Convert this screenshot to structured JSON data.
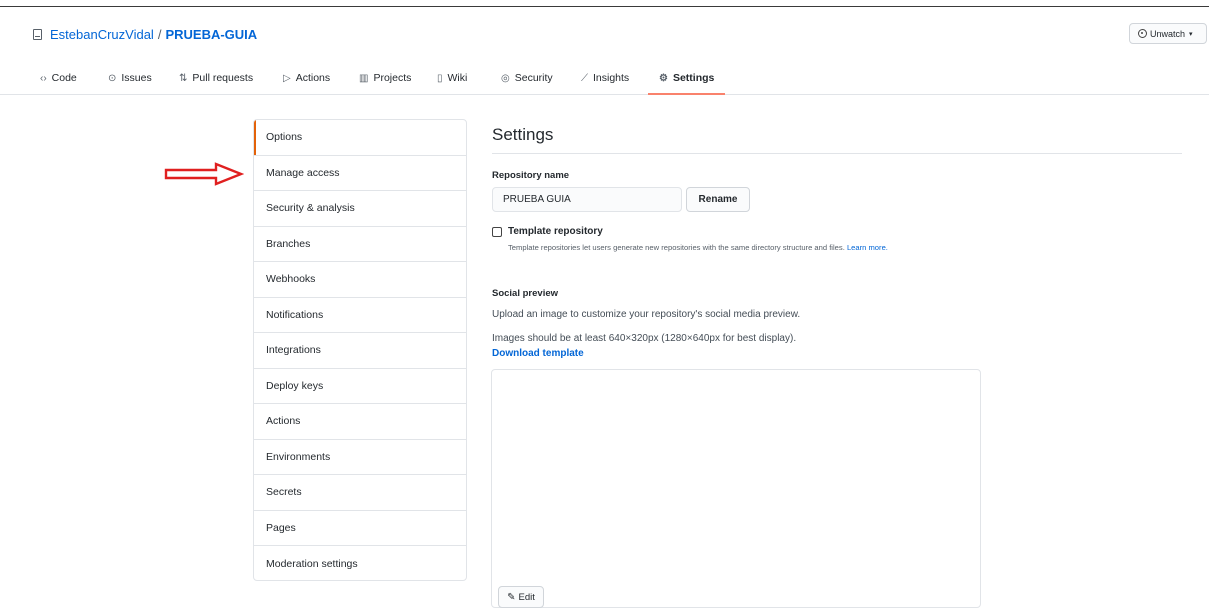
{
  "repo": {
    "owner": "EstebanCruzVidal",
    "separator": "/",
    "name": "PRUEBA-GUIA",
    "icon": "repo-icon"
  },
  "watch": {
    "label": "Unwatch",
    "icon": "eye-icon"
  },
  "tabs": [
    {
      "label": "Code",
      "icon": "code-icon",
      "glyph": "‹›"
    },
    {
      "label": "Issues",
      "icon": "issue-icon",
      "glyph": "⊙"
    },
    {
      "label": "Pull requests",
      "icon": "pull-request-icon",
      "glyph": "⇅"
    },
    {
      "label": "Actions",
      "icon": "play-icon",
      "glyph": "▷"
    },
    {
      "label": "Projects",
      "icon": "project-icon",
      "glyph": "▥"
    },
    {
      "label": "Wiki",
      "icon": "book-icon",
      "glyph": "▯"
    },
    {
      "label": "Security",
      "icon": "shield-icon",
      "glyph": "◎"
    },
    {
      "label": "Insights",
      "icon": "graph-icon",
      "glyph": "⟋"
    },
    {
      "label": "Settings",
      "icon": "gear-icon",
      "glyph": "⚙"
    }
  ],
  "sidebar": {
    "items": [
      {
        "label": "Options"
      },
      {
        "label": "Manage access"
      },
      {
        "label": "Security & analysis"
      },
      {
        "label": "Branches"
      },
      {
        "label": "Webhooks"
      },
      {
        "label": "Notifications"
      },
      {
        "label": "Integrations"
      },
      {
        "label": "Deploy keys"
      },
      {
        "label": "Actions"
      },
      {
        "label": "Environments"
      },
      {
        "label": "Secrets"
      },
      {
        "label": "Pages"
      },
      {
        "label": "Moderation settings"
      }
    ]
  },
  "settings": {
    "title": "Settings",
    "repo_name_label": "Repository name",
    "repo_name_value": "PRUEBA GUIA",
    "rename_label": "Rename",
    "template_label": "Template repository",
    "template_note": "Template repositories let users generate new repositories with the same directory structure and files.",
    "learn_more": "Learn more.",
    "social_preview_label": "Social preview",
    "social_preview_desc": "Upload an image to customize your repository's social media preview.",
    "image_size_note": "Images should be at least 640×320px (1280×640px for best display).",
    "download_template": "Download template",
    "edit_label": "Edit"
  },
  "colors": {
    "accent": "#0366d6",
    "active_tab_underline": "#f9826c",
    "arrow": "#e02020"
  }
}
